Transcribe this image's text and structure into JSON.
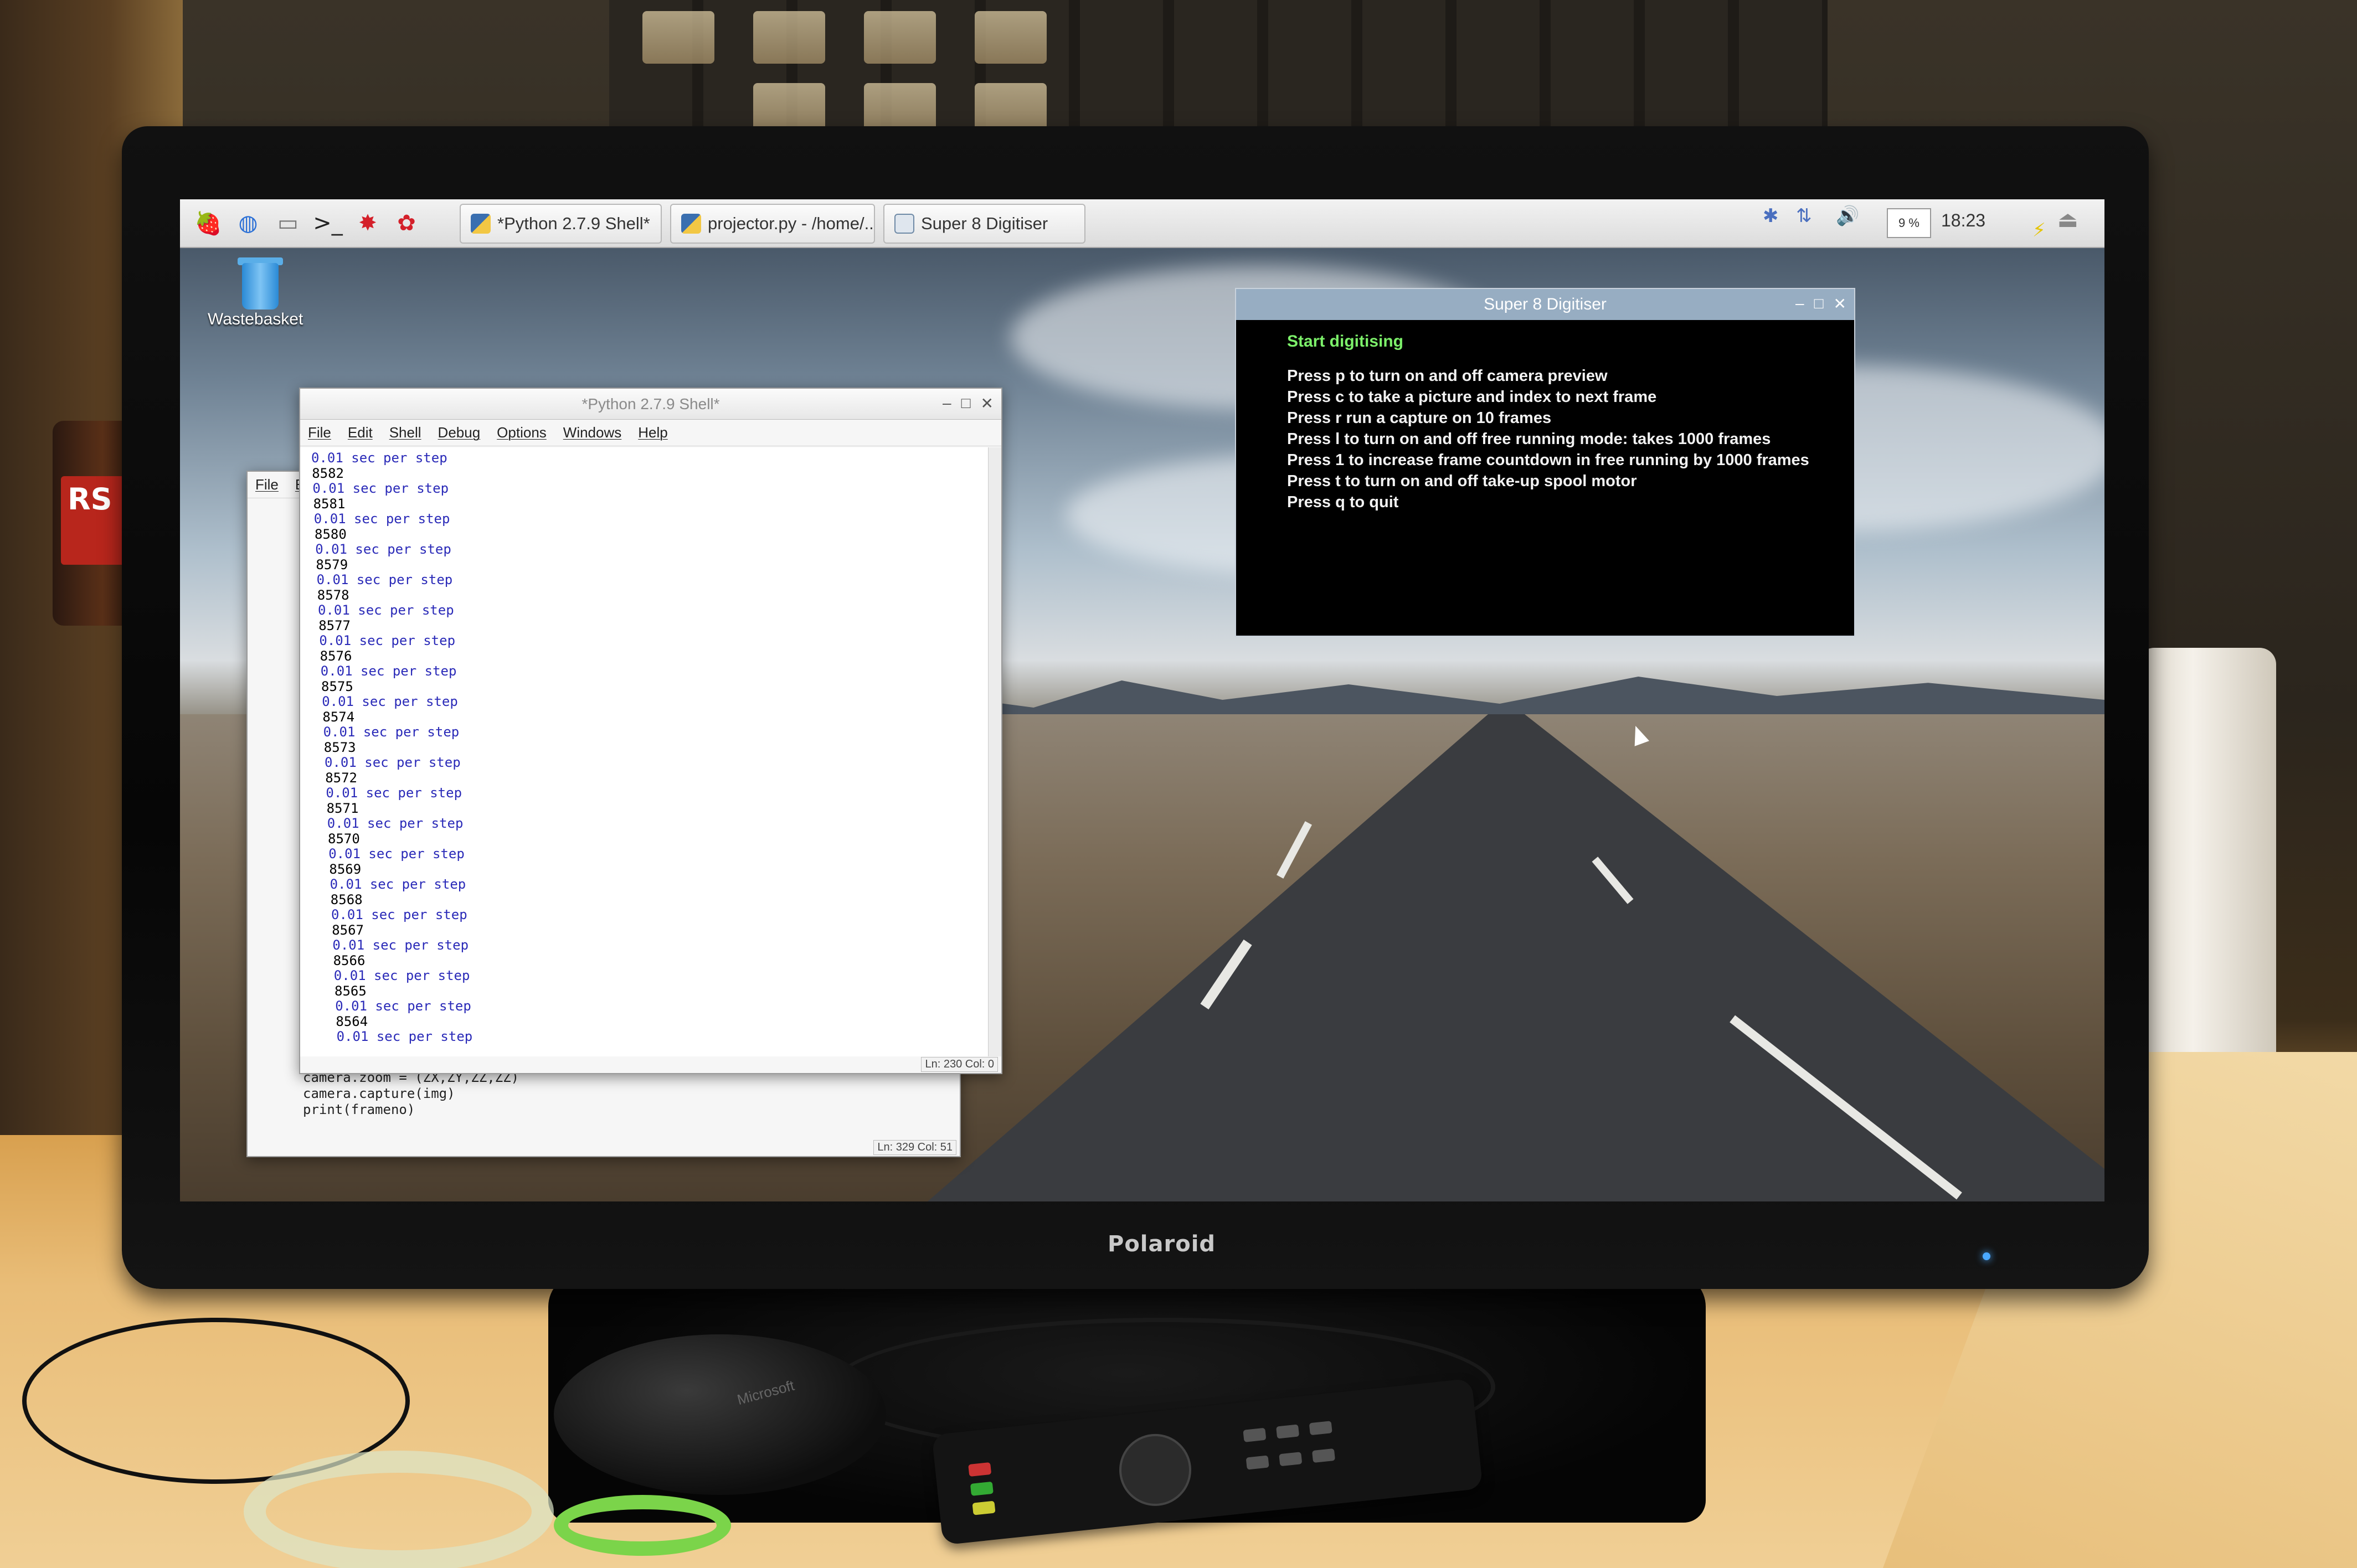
{
  "monitor": {
    "brand": "Polaroid"
  },
  "taskbar": {
    "launchers": [
      {
        "name": "raspberry-menu-icon",
        "glyph": "🍓",
        "color": "#c51a4a"
      },
      {
        "name": "web-browser-icon",
        "glyph": "◍",
        "color": "#2a6fd6"
      },
      {
        "name": "file-manager-icon",
        "glyph": "▭",
        "color": "#777777"
      },
      {
        "name": "terminal-icon",
        "glyph": ">_",
        "color": "#222222"
      },
      {
        "name": "math-icon",
        "glyph": "✸",
        "color": "#d4202a"
      },
      {
        "name": "wolfram-icon",
        "glyph": "✿",
        "color": "#d4202a"
      }
    ],
    "tasks": [
      {
        "label": "*Python 2.7.9 Shell*"
      },
      {
        "label": "projector.py - /home/..."
      },
      {
        "label": "Super 8 Digitiser"
      }
    ],
    "cpu_label": "9 %",
    "clock": "18:23"
  },
  "desktop": {
    "trash_label": "Wastebasket"
  },
  "shell_window": {
    "title": "*Python 2.7.9 Shell*",
    "menu": [
      "File",
      "Edit",
      "Shell",
      "Debug",
      "Options",
      "Windows",
      "Help"
    ],
    "lines": [
      "0.01 sec per step",
      "8582",
      "0.01 sec per step",
      "8581",
      "0.01 sec per step",
      "8580",
      "0.01 sec per step",
      "8579",
      "0.01 sec per step",
      "8578",
      "0.01 sec per step",
      "8577",
      "0.01 sec per step",
      "8576",
      "0.01 sec per step",
      "8575",
      "0.01 sec per step",
      "8574",
      "0.01 sec per step",
      "8573",
      "0.01 sec per step",
      "8572",
      "0.01 sec per step",
      "8571",
      "0.01 sec per step",
      "8570",
      "0.01 sec per step",
      "8569",
      "0.01 sec per step",
      "8568",
      "0.01 sec per step",
      "8567",
      "0.01 sec per step",
      "8566",
      "0.01 sec per step",
      "8565",
      "0.01 sec per step",
      "8564",
      "0.01 sec per step"
    ],
    "status": "Ln: 230 Col: 0"
  },
  "editor_window": {
    "menu": [
      "File",
      "Ed"
    ],
    "code": [
      "camera.zoom = (ZX,ZY,ZZ,ZZ)",
      "camera.capture(img)",
      "print(frameno)"
    ],
    "status": "Ln: 329 Col: 51"
  },
  "digitiser_window": {
    "title": "Super 8 Digitiser",
    "heading": "Start digitising",
    "instructions": [
      "Press p to turn on and off camera preview",
      "Press c to take a picture and index to next frame",
      "Press r run a capture on 10 frames",
      "Press l to turn on and off free running mode: takes 1000 frames",
      "Press 1 to increase frame countdown in free running by 1000 frames",
      "Press t to turn on and off take-up spool motor",
      "Press q to quit"
    ]
  },
  "desk": {
    "jar_label": "RS",
    "mouse_brand": "Microsoft"
  }
}
